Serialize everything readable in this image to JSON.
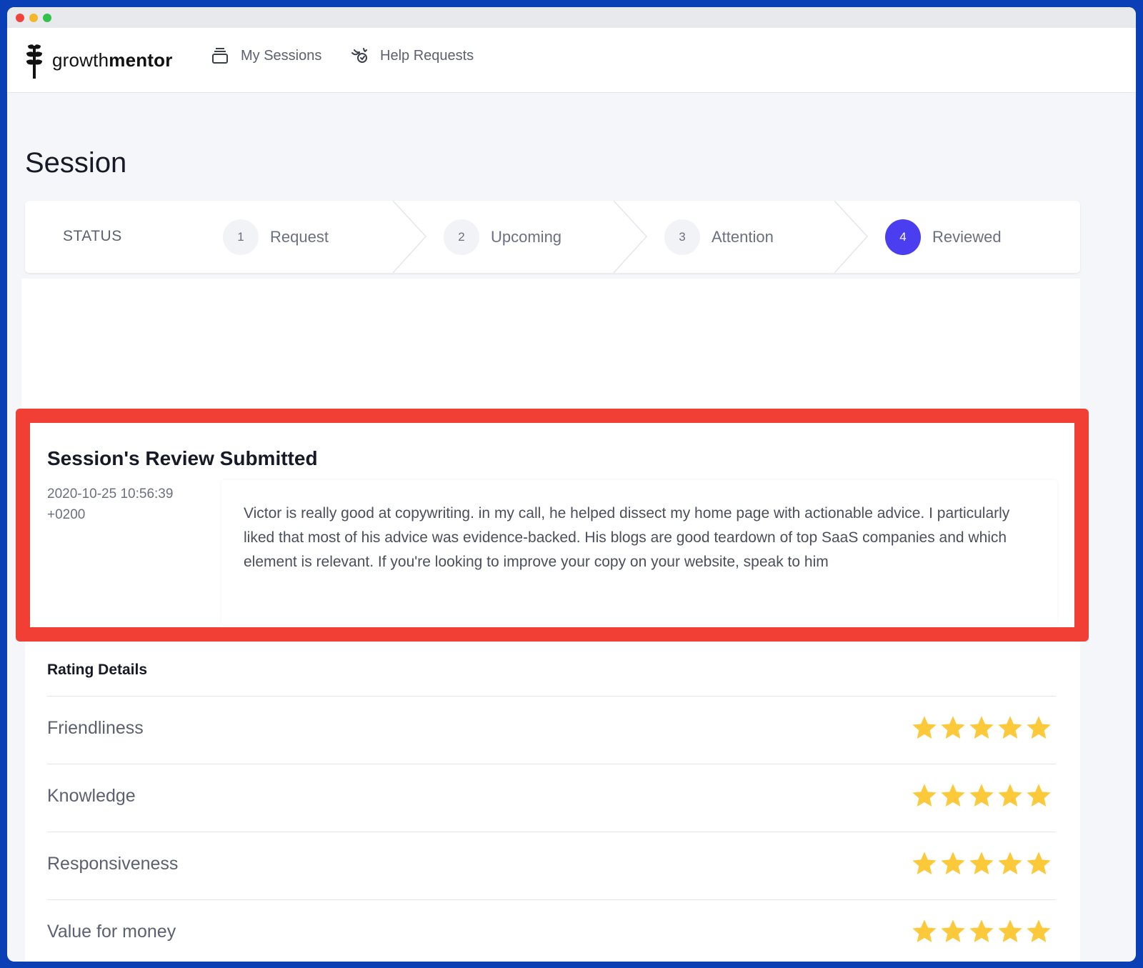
{
  "app": {
    "brand_light": "growth",
    "brand_bold": "mentor"
  },
  "nav": [
    {
      "label": "My Sessions",
      "icon": "stack-icon"
    },
    {
      "label": "Help Requests",
      "icon": "helping-hand-icon"
    }
  ],
  "page": {
    "title": "Session"
  },
  "status": {
    "label": "STATUS",
    "steps": [
      {
        "number": "1",
        "name": "Request",
        "active": false
      },
      {
        "number": "2",
        "name": "Upcoming",
        "active": false
      },
      {
        "number": "3",
        "name": "Attention",
        "active": false
      },
      {
        "number": "4",
        "name": "Reviewed",
        "active": true
      }
    ]
  },
  "review": {
    "title": "Session's Review Submitted",
    "date": "2020-10-25 10:56:39 +0200",
    "text": "Victor is really good at copywriting. in my call, he helped dissect my home page with actionable advice. I particularly liked that most of his advice was evidence-backed. His blogs are good teardown of top SaaS companies and which element is relevant. If you're looking to improve your copy on your website, speak to him"
  },
  "rating": {
    "title": "Rating Details",
    "rows": [
      {
        "label": "Friendliness",
        "stars": 5
      },
      {
        "label": "Knowledge",
        "stars": 5
      },
      {
        "label": "Responsiveness",
        "stars": 5
      },
      {
        "label": "Value for money",
        "stars": 5
      }
    ]
  },
  "colors": {
    "accent": "#4a3ef0",
    "highlight": "#f23f36",
    "star": "#fcc93a",
    "frame": "#0a3fb5"
  }
}
